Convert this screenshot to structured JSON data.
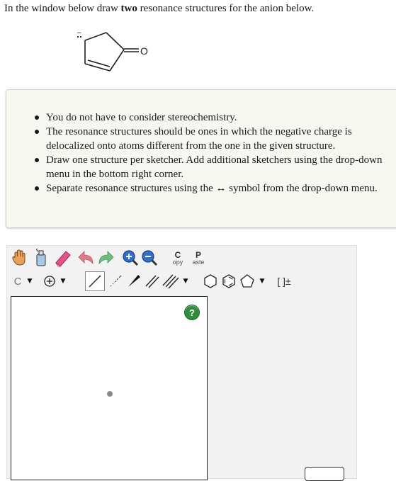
{
  "question": {
    "prefix": "In the window below draw ",
    "emphasis": "two",
    "suffix": " resonance structures for the anion below."
  },
  "molecule": {
    "oxygen_label": "O",
    "charge_label": "−",
    "lone_pair": "∶"
  },
  "instructions": [
    "You do not have to consider stereochemistry.",
    "The resonance structures should be ones in which the negative charge is delocalized onto atoms different from the one in the given structure.",
    "Draw one structure per sketcher. Add additional sketchers using the drop-down menu in the bottom right corner.",
    "Separate resonance structures using the ↔ symbol from the drop-down menu."
  ],
  "toolbar": {
    "copy_top": "C",
    "copy_bottom": "opy",
    "paste_top": "P",
    "paste_bottom": "aste",
    "element_label": "C",
    "bracket_label": "[ ]±"
  },
  "canvas": {
    "help_label": "?"
  },
  "colors": {
    "info_bg": "#f7f7f2",
    "sketcher_bg": "#f2f2f2",
    "help_green": "#2f8f3a",
    "eraser_pink": "#e8508a",
    "undo_pink": "#e07a86",
    "redo_green": "#6bbf7a"
  }
}
